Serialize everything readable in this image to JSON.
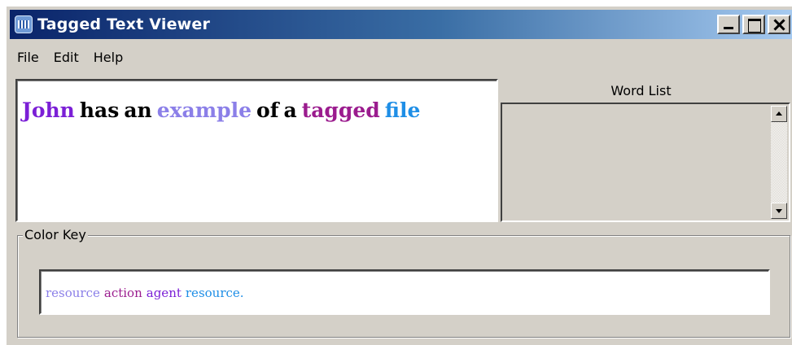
{
  "window": {
    "title": "Tagged Text Viewer",
    "icon": "app-icon",
    "caption_buttons": [
      "minimize-icon",
      "maximize-icon",
      "close-icon"
    ],
    "colors": {
      "title_start": "#0a246a",
      "title_end": "#a6caf0",
      "face": "#d4d0c8"
    }
  },
  "menu": {
    "file": "File",
    "edit": "Edit",
    "help": "Help"
  },
  "text_area": {
    "words": [
      {
        "text": "John",
        "color": "#7b1fd6"
      },
      {
        "text": "has",
        "color": "#000000"
      },
      {
        "text": "an",
        "color": "#000000"
      },
      {
        "text": "example",
        "color": "#8b7fe8"
      },
      {
        "text": "of",
        "color": "#000000"
      },
      {
        "text": "a",
        "color": "#000000"
      },
      {
        "text": "tagged",
        "color": "#9b1c8e"
      },
      {
        "text": "file",
        "color": "#1e8ee6"
      }
    ]
  },
  "word_list": {
    "header": "Word List",
    "items": []
  },
  "color_key": {
    "label": "Color Key",
    "entries": [
      {
        "text": "resource",
        "color": "#8b7fe8"
      },
      {
        "text": "action",
        "color": "#9b1c8e"
      },
      {
        "text": "agent",
        "color": "#7b1fd6"
      },
      {
        "text": "resource.",
        "color": "#1e8ee6"
      }
    ]
  }
}
